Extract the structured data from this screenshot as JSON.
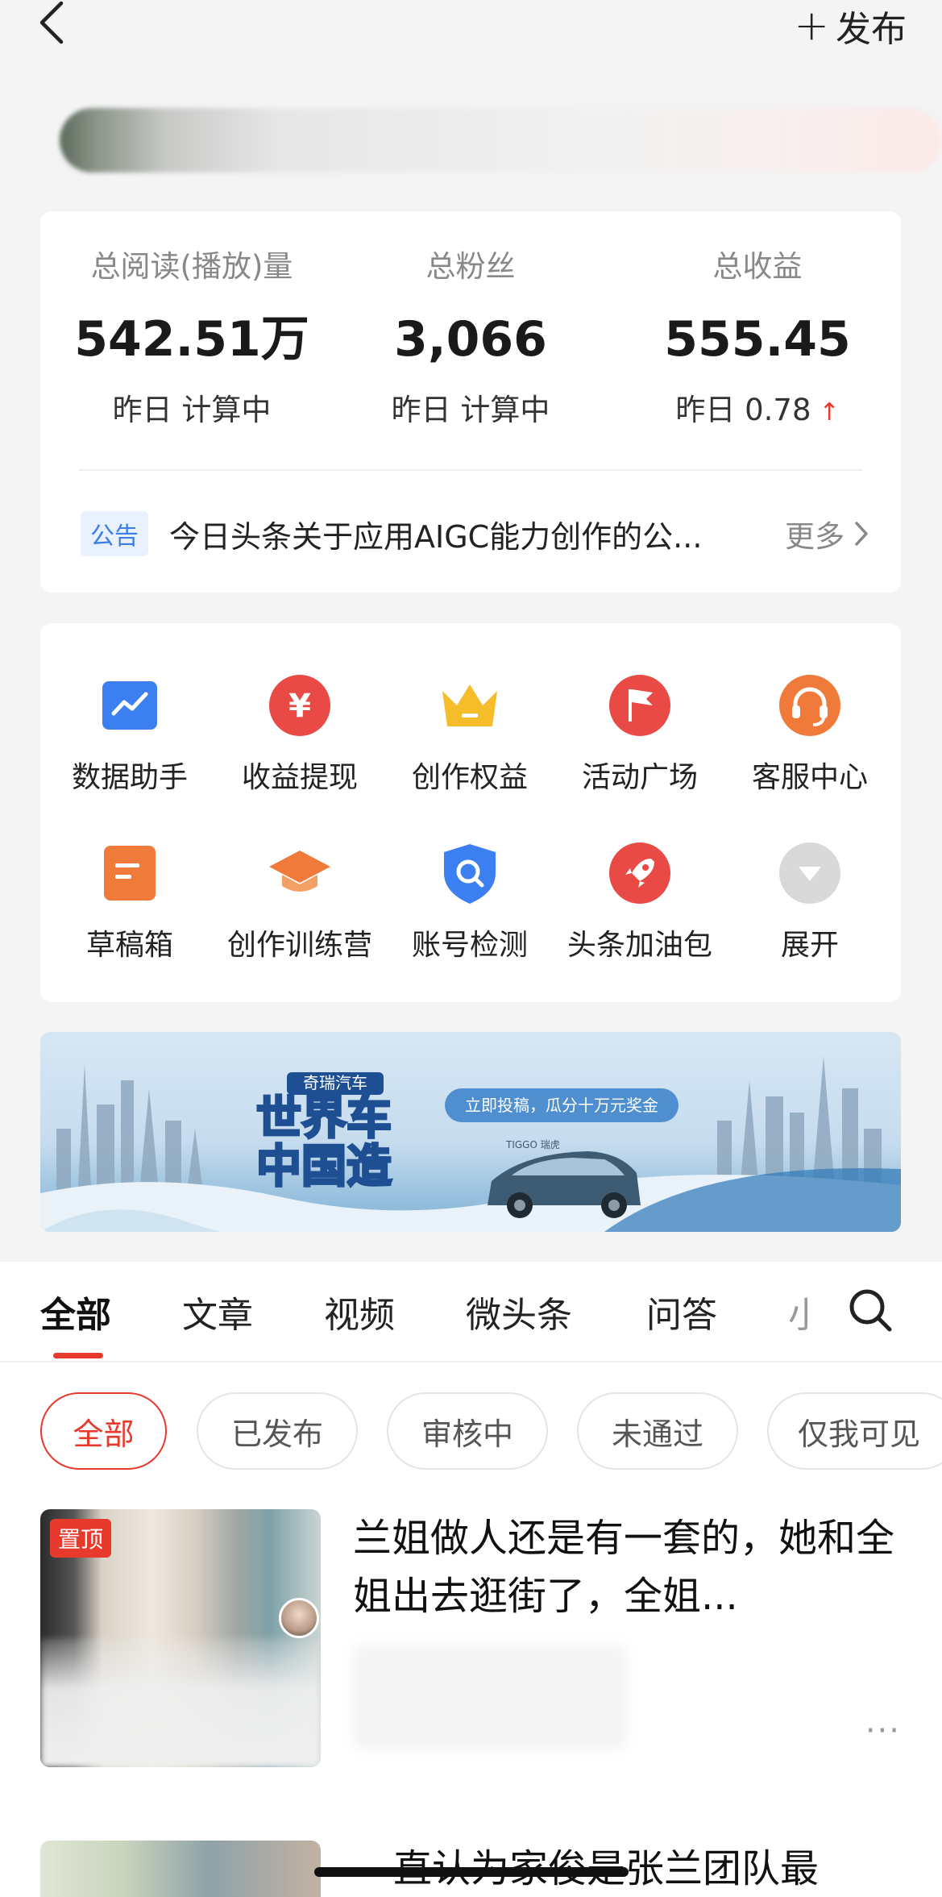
{
  "header": {
    "publish_plus": "+",
    "publish_label": "发布"
  },
  "stats": [
    {
      "label": "总阅读(播放)量",
      "value": "542.51万",
      "sub": "昨日 计算中"
    },
    {
      "label": "总粉丝",
      "value": "3,066",
      "sub": "昨日 计算中"
    },
    {
      "label": "总收益",
      "value": "555.45",
      "sub": "昨日 0.78",
      "trend": "↑"
    }
  ],
  "notice": {
    "badge": "公告",
    "text": "今日头条关于应用AIGC能力创作的公...",
    "more": "更多"
  },
  "tools": [
    {
      "label": "数据助手",
      "icon": "chart-icon",
      "color": "#3b7ff0"
    },
    {
      "label": "收益提现",
      "icon": "yuan-icon",
      "color": "#ea4a45"
    },
    {
      "label": "创作权益",
      "icon": "crown-icon",
      "color": "#f6bd2a"
    },
    {
      "label": "活动广场",
      "icon": "flag-icon",
      "color": "#ea4a45"
    },
    {
      "label": "客服中心",
      "icon": "headset-icon",
      "color": "#f07a3a"
    },
    {
      "label": "草稿箱",
      "icon": "draft-icon",
      "color": "#f07a3a"
    },
    {
      "label": "创作训练营",
      "icon": "graduation-cap-icon",
      "color": "#f07a3a"
    },
    {
      "label": "账号检测",
      "icon": "shield-search-icon",
      "color": "#3b7ff0"
    },
    {
      "label": "头条加油包",
      "icon": "rocket-icon",
      "color": "#ea4a45"
    },
    {
      "label": "展开",
      "icon": "expand-icon",
      "color": "#d9d9d9"
    }
  ],
  "banner": {
    "brand": "奇瑞汽车",
    "title_line1": "世界车",
    "title_line2": "中国造",
    "cta": "立即投稿，瓜分十万元奖金",
    "car_model": "TIGGO 瑞虎"
  },
  "tabs": [
    "全部",
    "文章",
    "视频",
    "微头条",
    "问答",
    "小"
  ],
  "filters": [
    "全部",
    "已发布",
    "审核中",
    "未通过",
    "仅我可见"
  ],
  "articles": [
    {
      "pin": "置顶",
      "title": "兰姐做人还是有一套的，她和全姐出去逛街了，全姐...",
      "more": "···"
    },
    {
      "title": "直认为家俊是张兰团队最"
    }
  ]
}
